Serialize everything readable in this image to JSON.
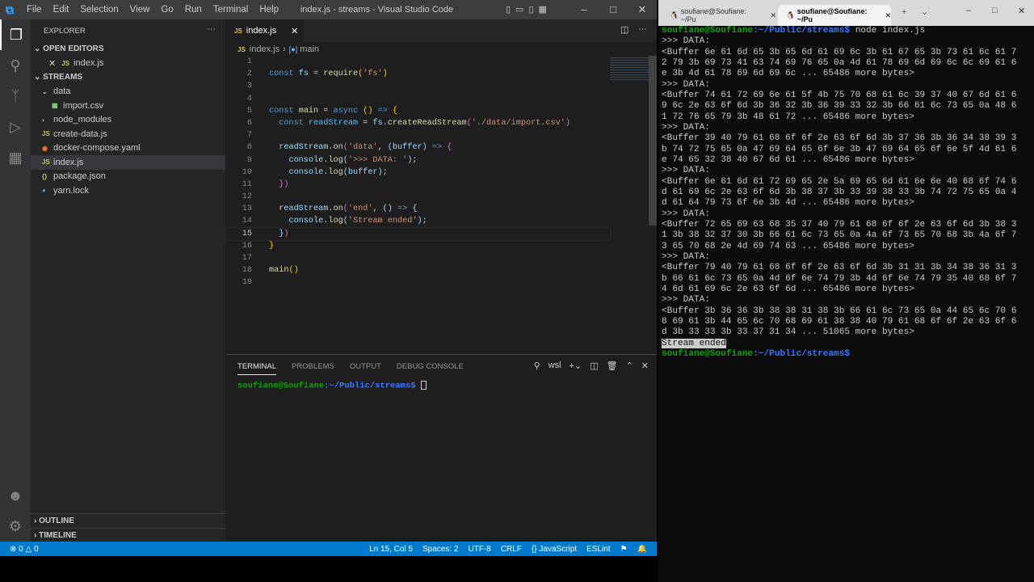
{
  "vscode": {
    "menu": [
      "File",
      "Edit",
      "Selection",
      "View",
      "Go",
      "Run",
      "Terminal",
      "Help"
    ],
    "window_title": "index.js - streams - Visual Studio Code",
    "explorer_title": "EXPLORER",
    "open_editors": "OPEN EDITORS",
    "open_file": "index.js",
    "folder": "STREAMS",
    "tree": [
      {
        "label": "data",
        "kind": "folder-open",
        "depth": 1
      },
      {
        "label": "import.csv",
        "kind": "csv",
        "depth": 2
      },
      {
        "label": "node_modules",
        "kind": "folder",
        "depth": 1
      },
      {
        "label": "create-data.js",
        "kind": "js",
        "depth": 1
      },
      {
        "label": "docker-compose.yaml",
        "kind": "yaml",
        "depth": 1
      },
      {
        "label": "index.js",
        "kind": "js",
        "depth": 1,
        "selected": true
      },
      {
        "label": "package.json",
        "kind": "json",
        "depth": 1
      },
      {
        "label": "yarn.lock",
        "kind": "lock",
        "depth": 1
      }
    ],
    "outline": "OUTLINE",
    "timeline": "TIMELINE",
    "tab": "index.js",
    "breadcrumb": [
      "index.js",
      "main"
    ],
    "code": [
      [],
      [
        [
          "const",
          "k"
        ],
        [
          " ",
          "p"
        ],
        [
          "fs",
          "v"
        ],
        [
          " = ",
          "p"
        ],
        [
          "require",
          "f"
        ],
        [
          "(",
          "y"
        ],
        [
          "'fs'",
          "s"
        ],
        [
          ")",
          "y"
        ]
      ],
      [],
      [],
      [
        [
          "const",
          "k"
        ],
        [
          " ",
          "p"
        ],
        [
          "main",
          "f"
        ],
        [
          " = ",
          "p"
        ],
        [
          "async",
          "k"
        ],
        [
          " ",
          "p"
        ],
        [
          "()",
          "y"
        ],
        [
          " => ",
          "k"
        ],
        [
          "{",
          "y"
        ]
      ],
      [
        [
          "  const",
          "k"
        ],
        [
          " ",
          "p"
        ],
        [
          "readStream",
          "c"
        ],
        [
          " = ",
          "p"
        ],
        [
          "fs",
          "v"
        ],
        [
          ".",
          "p"
        ],
        [
          "createReadStream",
          "f"
        ],
        [
          "(",
          "m"
        ],
        [
          "'./data/import.csv'",
          "s"
        ],
        [
          ")",
          "m"
        ]
      ],
      [],
      [
        [
          "  readStream",
          "v"
        ],
        [
          ".",
          "p"
        ],
        [
          "on",
          "f"
        ],
        [
          "(",
          "m"
        ],
        [
          "'data'",
          "s"
        ],
        [
          ", ",
          "p"
        ],
        [
          "(",
          "v"
        ],
        [
          "buffer",
          "v"
        ],
        [
          ")",
          "v"
        ],
        [
          " => ",
          "k"
        ],
        [
          "{",
          "m"
        ]
      ],
      [
        [
          "    console",
          "v"
        ],
        [
          ".",
          "p"
        ],
        [
          "log",
          "f"
        ],
        [
          "(",
          "v"
        ],
        [
          "'>>> DATA: '",
          "s"
        ],
        [
          ")",
          "v"
        ],
        [
          ";",
          "p"
        ]
      ],
      [
        [
          "    console",
          "v"
        ],
        [
          ".",
          "p"
        ],
        [
          "log",
          "f"
        ],
        [
          "(",
          "v"
        ],
        [
          "buffer",
          "v"
        ],
        [
          ")",
          "v"
        ],
        [
          ";",
          "p"
        ]
      ],
      [
        [
          "  }",
          "m"
        ],
        [
          ")",
          "m"
        ]
      ],
      [],
      [
        [
          "  readStream",
          "v"
        ],
        [
          ".",
          "p"
        ],
        [
          "on",
          "f"
        ],
        [
          "(",
          "m"
        ],
        [
          "'end'",
          "s"
        ],
        [
          ", ",
          "p"
        ],
        [
          "()",
          "v"
        ],
        [
          " => ",
          "k"
        ],
        [
          "{",
          "v"
        ]
      ],
      [
        [
          "    console",
          "v"
        ],
        [
          ".",
          "p"
        ],
        [
          "log",
          "f"
        ],
        [
          "(",
          "v"
        ],
        [
          "'Stream ended'",
          "s"
        ],
        [
          ")",
          "v"
        ],
        [
          ";",
          "p"
        ]
      ],
      [
        [
          "  }",
          "v"
        ],
        [
          ")",
          "m"
        ]
      ],
      [
        [
          "}",
          "y"
        ]
      ],
      [],
      [
        [
          "main",
          "f"
        ],
        [
          "()",
          "y"
        ]
      ],
      []
    ],
    "panel_tabs": [
      "TERMINAL",
      "PROBLEMS",
      "OUTPUT",
      "DEBUG CONSOLE"
    ],
    "panel_shell": "wsl",
    "panel_prompt_user": "soufiane@Soufiane",
    "panel_prompt_path": ":~/Public/streams$",
    "status": {
      "errors": "0",
      "warnings": "0",
      "position": "Ln 15, Col 5",
      "spaces": "Spaces: 2",
      "encoding": "UTF-8",
      "eol": "CRLF",
      "language": "JavaScript",
      "linter": "ESLint"
    }
  },
  "terminal": {
    "tabs": [
      "soufiane@Soufiane: ~/Pu",
      "soufiane@Soufiane: ~/Pu"
    ],
    "prompt_user": "soufiane@Soufiane",
    "prompt_path": ":~/Public/streams$",
    "command": " node index.js",
    "lines": [
      ">>> DATA:",
      "<Buffer 6e 61 6d 65 3b 65 6d 61 69 6c 3b 61 67 65 3b 73 61 6c 61 7",
      "2 79 3b 69 73 41 63 74 69 76 65 0a 4d 61 78 69 6d 69 6c 6c 69 61 6",
      "e 3b 4d 61 78 69 6d 69 6c ... 65486 more bytes>",
      ">>> DATA:",
      "<Buffer 74 61 72 69 6e 61 5f 4b 75 70 68 61 6c 39 37 40 67 6d 61 6",
      "9 6c 2e 63 6f 6d 3b 36 32 3b 36 39 33 32 3b 66 61 6c 73 65 0a 48 6",
      "1 72 76 65 79 3b 48 61 72 ... 65486 more bytes>",
      ">>> DATA:",
      "<Buffer 39 40 79 61 68 6f 6f 2e 63 6f 6d 3b 37 36 3b 36 34 38 39 3",
      "b 74 72 75 65 0a 47 69 64 65 6f 6e 3b 47 69 64 65 6f 6e 5f 4d 61 6",
      "e 74 65 32 38 40 67 6d 61 ... 65486 more bytes>",
      ">>> DATA:",
      "<Buffer 6e 61 6d 61 72 69 65 2e 5a 69 65 6d 61 6e 6e 40 68 6f 74 6",
      "d 61 69 6c 2e 63 6f 6d 3b 38 37 3b 33 39 38 33 3b 74 72 75 65 0a 4",
      "d 61 64 79 73 6f 6e 3b 4d ... 65486 more bytes>",
      ">>> DATA:",
      "<Buffer 72 65 69 63 68 35 37 40 79 61 68 6f 6f 2e 63 6f 6d 3b 38 3",
      "1 3b 38 32 37 30 3b 66 61 6c 73 65 0a 4a 6f 73 65 70 68 3b 4a 6f 7",
      "3 65 70 68 2e 4d 69 74 63 ... 65486 more bytes>",
      ">>> DATA:",
      "<Buffer 79 40 79 61 68 6f 6f 2e 63 6f 6d 3b 31 31 3b 34 38 36 31 3",
      "b 66 61 6c 73 65 0a 4d 6f 6e 74 79 3b 4d 6f 6e 74 79 35 40 68 6f 7",
      "4 6d 61 69 6c 2e 63 6f 6d ... 65486 more bytes>",
      ">>> DATA:",
      "<Buffer 3b 36 36 3b 38 38 31 38 3b 66 61 6c 73 65 0a 44 65 6c 70 6",
      "8 69 61 3b 44 65 6c 70 68 69 61 38 38 40 79 61 68 6f 6f 2e 63 6f 6",
      "d 3b 33 33 3b 33 37 31 34 ... 51065 more bytes>"
    ],
    "ended": "Stream ended"
  }
}
